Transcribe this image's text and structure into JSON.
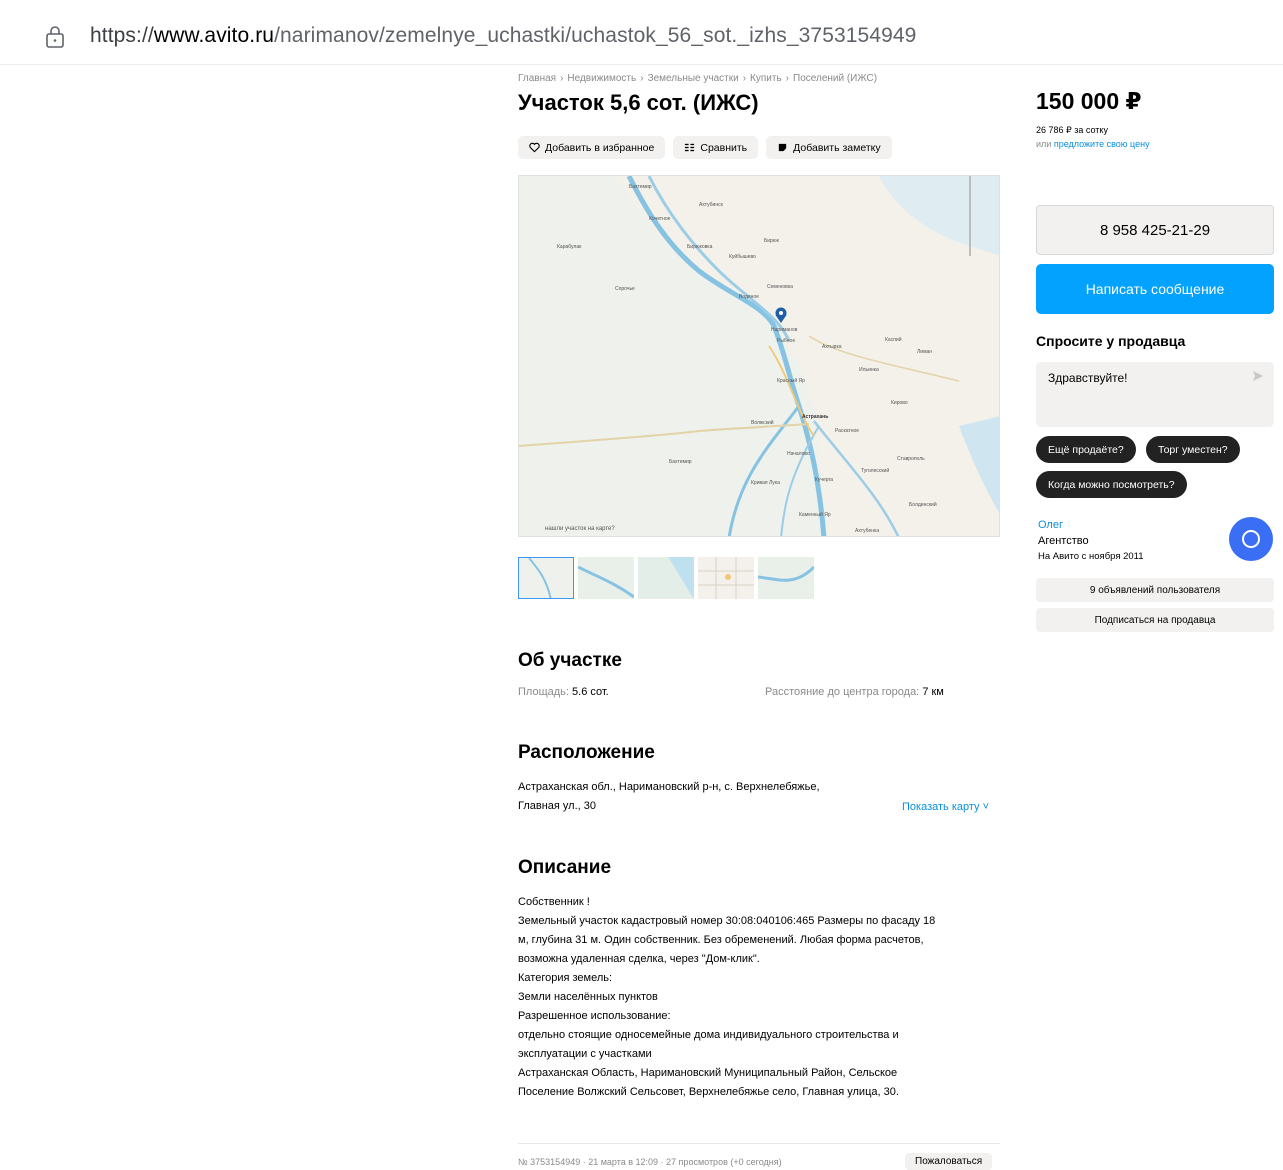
{
  "browser": {
    "url_scheme": "https://",
    "url_host": "www.avito.ru",
    "url_path": "/narimanov/zemelnye_uchastki/uchastok_56_sot._izhs_3753154949"
  },
  "breadcrumbs": [
    "Главная",
    "Недвижимость",
    "Земельные участки",
    "Купить",
    "Поселений (ИЖС)"
  ],
  "breadcrumb_sep": "›",
  "title": "Участок 5,6 сот. (ИЖС)",
  "actions": {
    "favorite": "Добавить в избранное",
    "compare": "Сравнить",
    "note": "Добавить заметку"
  },
  "map": {
    "labels": [
      "Бахтемир",
      "Ахтубинск",
      "Кочетное",
      "Карабулак",
      "Бирюковка",
      "Бирюк",
      "Куйбышево",
      "Сорочье",
      "Семеновка",
      "Водяное",
      "Нариманов",
      "Рыбное",
      "Ахтырка",
      "Каспий",
      "Лиман",
      "Ильинка",
      "Астрахань",
      "Красный Яр",
      "Волжский",
      "Раскатное",
      "Кирово",
      "Началово",
      "Бахтемир",
      "Туголесский",
      "Кривая Лука",
      "Кучерга",
      "Ставрополь",
      "Болдинский",
      "Каменный Яр",
      "Ахтубенка"
    ],
    "caption": "нашли участок на карте?"
  },
  "about": {
    "heading": "Об участке",
    "area_label": "Площадь:",
    "area_value": "5.6 сот.",
    "distance_label": "Расстояние до центра города:",
    "distance_value": "7 км"
  },
  "location": {
    "heading": "Расположение",
    "line1": "Астраханская обл., Наримановский р-н, с. Верхнелебяжье,",
    "line2": "Главная ул., 30",
    "show_map": "Показать карту ˅"
  },
  "description": {
    "heading": "Описание",
    "lines": [
      "Собственник !",
      "Земельный участок кадастровый номер 30:08:040106:465 Размеры по фасаду 18",
      "м, глубина 31 м. Один собственник. Без обременений. Любая форма расчетов,",
      "возможна удаленная сделка, через \"Дом-клик\".",
      "Категория земель:",
      "Земли населённых пунктов",
      "Разрешенное использование:",
      "отдельно стоящие односемейные дома индивидуального строительства и",
      "эксплуатации с участками",
      "Астраханская Область, Наримановский Муниципальный Район, Сельское",
      "Поселение Волжский Сельсовет, Верхнелебяжье село, Главная улица, 30."
    ]
  },
  "footer": {
    "meta": "№ 3753154949 · 21 марта в 12:09 · 27 просмотров (+0 сегодня)",
    "complain": "Пожаловаться"
  },
  "sidebar": {
    "price": "150 000 ₽",
    "per_sotka": "26 786 ₽ за сотку",
    "offer_prefix": "или",
    "offer_link": "предложите свою цену",
    "phone": "8 958 425-21-29",
    "message_button": "Написать сообщение",
    "ask_title": "Спросите у продавца",
    "ask_placeholder": "Здравствуйте!",
    "chips": [
      "Ещё продаёте?",
      "Торг уместен?",
      "Когда можно посмотреть?"
    ],
    "seller_name": "Олег",
    "seller_type": "Агентство",
    "seller_since": "На Авито с ноября 2011",
    "listings_button": "9 объявлений пользователя",
    "subscribe_button": "Подписаться на продавца"
  },
  "colors": {
    "accent": "#04a2ff",
    "link": "#0a8fe0",
    "avatar": "#3a6ff5",
    "map_pin": "#1f5fa8"
  }
}
